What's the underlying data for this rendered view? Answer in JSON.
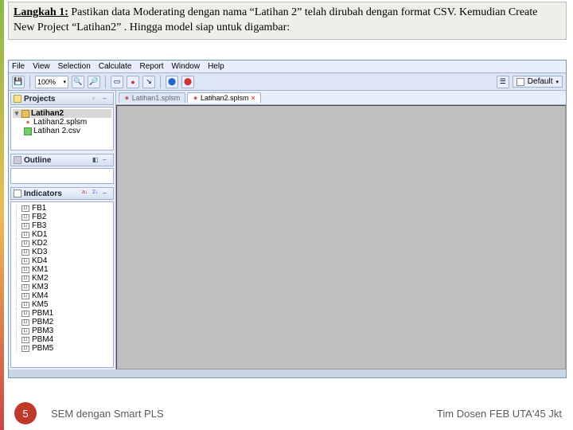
{
  "instruction": {
    "label": "Langkah 1:",
    "text": " Pastikan data Moderating dengan nama “Latihan 2” telah dirubah dengan format CSV. Kemudian Create New Project “Latihan2” . Hingga model siap untuk digambar:"
  },
  "app": {
    "menu": [
      "File",
      "View",
      "Selection",
      "Calculate",
      "Report",
      "Window",
      "Help"
    ],
    "zoom": "100%",
    "theme_label": "Default",
    "panels": {
      "projects": {
        "title": "Projects"
      },
      "tree": {
        "root": "Latihan2",
        "children": [
          {
            "name": "Latihan2.splsm",
            "kind": "model"
          },
          {
            "name": "Latihan 2.csv",
            "kind": "data"
          }
        ]
      },
      "outline": {
        "title": "Outline"
      },
      "indicators": {
        "title": "Indicators",
        "items": [
          "FB1",
          "FB2",
          "FB3",
          "KD1",
          "KD2",
          "KD3",
          "KD4",
          "KM1",
          "KM2",
          "KM3",
          "KM4",
          "KM5",
          "PBM1",
          "PBM2",
          "PBM3",
          "PBM4",
          "PBM5"
        ]
      }
    },
    "tabs": [
      {
        "label": "Latihan1.splsm",
        "active": false
      },
      {
        "label": "Latihan2.splsm",
        "active": true
      }
    ]
  },
  "footer": {
    "page": "5",
    "title": "SEM dengan Smart PLS",
    "author": "Tim Dosen FEB UTA'45 Jkt"
  }
}
